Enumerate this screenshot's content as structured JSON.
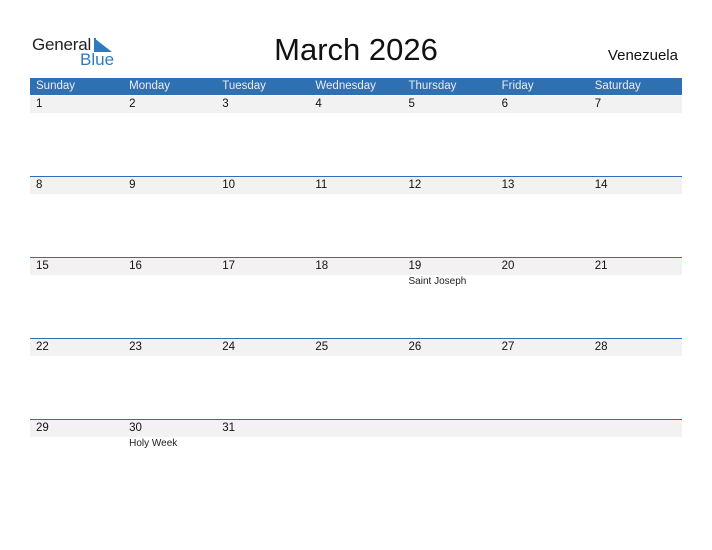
{
  "logo": {
    "word1": "General",
    "word2": "Blue"
  },
  "title": "March 2026",
  "country": "Venezuela",
  "colors": {
    "accent": "#2e70b2",
    "day_strip": "#f2f2f2"
  },
  "weekdays": [
    "Sunday",
    "Monday",
    "Tuesday",
    "Wednesday",
    "Thursday",
    "Friday",
    "Saturday"
  ],
  "weeks": [
    {
      "days": [
        "1",
        "2",
        "3",
        "4",
        "5",
        "6",
        "7"
      ],
      "events": [
        "",
        "",
        "",
        "",
        "",
        "",
        ""
      ]
    },
    {
      "days": [
        "8",
        "9",
        "10",
        "11",
        "12",
        "13",
        "14"
      ],
      "events": [
        "",
        "",
        "",
        "",
        "",
        "",
        ""
      ]
    },
    {
      "days": [
        "15",
        "16",
        "17",
        "18",
        "19",
        "20",
        "21"
      ],
      "events": [
        "",
        "",
        "",
        "",
        "Saint Joseph",
        "",
        ""
      ]
    },
    {
      "days": [
        "22",
        "23",
        "24",
        "25",
        "26",
        "27",
        "28"
      ],
      "events": [
        "",
        "",
        "",
        "",
        "",
        "",
        ""
      ]
    },
    {
      "days": [
        "29",
        "30",
        "31",
        "",
        "",
        "",
        ""
      ],
      "events": [
        "",
        "Holy Week",
        "",
        "",
        "",
        "",
        ""
      ]
    }
  ]
}
